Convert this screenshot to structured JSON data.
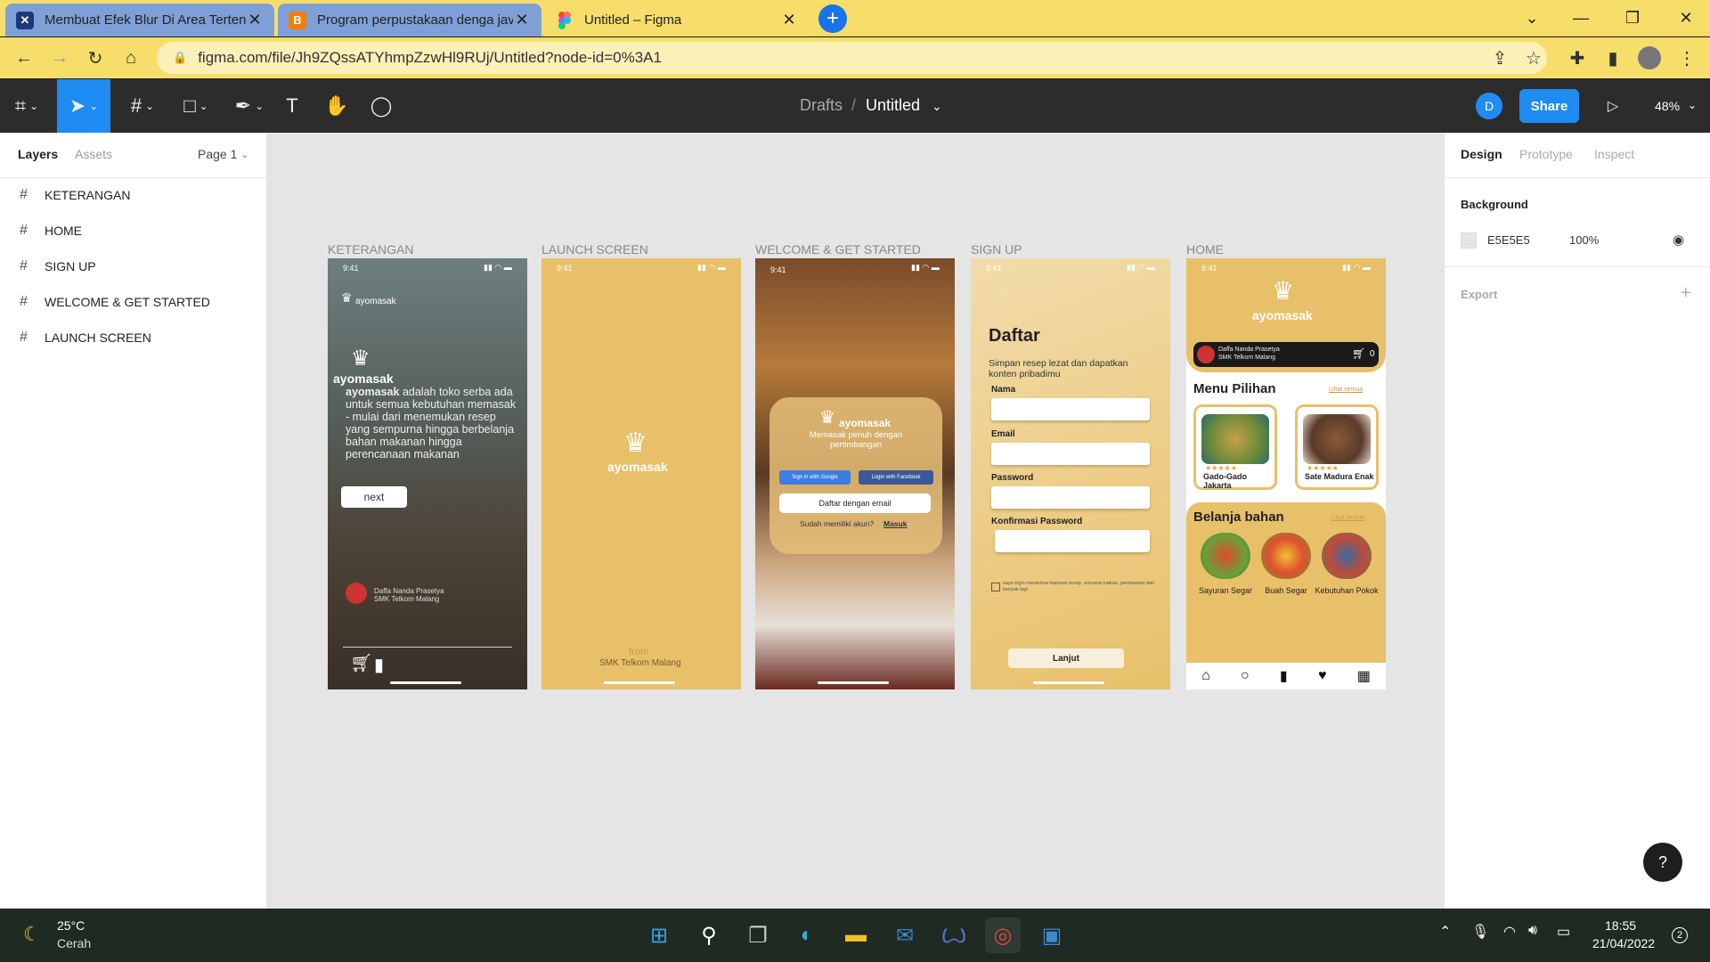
{
  "browser": {
    "tabs": [
      {
        "title": "Membuat Efek Blur Di Area Tertentu",
        "favicon": "joomla-icon"
      },
      {
        "title": "Program perpustakaan denga java",
        "favicon": "blogger-icon"
      },
      {
        "title": "Untitled – Figma",
        "favicon": "figma-icon"
      }
    ],
    "url": "figma.com/file/Jh9ZQssATYhmpZzwHl9RUj/Untitled?node-id=0%3A1"
  },
  "figma": {
    "breadcrumb_parent": "Drafts",
    "separator": "/",
    "file_name": "Untitled",
    "avatar_initial": "D",
    "share_label": "Share",
    "zoom": "48%",
    "left_tabs": {
      "layers": "Layers",
      "assets": "Assets",
      "page": "Page 1"
    },
    "layers": [
      "KETERANGAN",
      "HOME",
      "SIGN UP",
      "WELCOME & GET STARTED",
      "LAUNCH SCREEN"
    ],
    "right_tabs": {
      "design": "Design",
      "prototype": "Prototype",
      "inspect": "Inspect"
    },
    "background_label": "Background",
    "background_hex": "E5E5E5",
    "background_opacity": "100%",
    "export_label": "Export",
    "help": "?"
  },
  "frames": {
    "labels": [
      "KETERANGAN",
      "LAUNCH SCREEN",
      "WELCOME & GET STARTED",
      "SIGN UP",
      "HOME"
    ],
    "time": "9:41",
    "brand": "ayomasak",
    "keterangan": {
      "desc_bold": "ayomasak",
      "desc": "adalah toko serba ada untuk semua kebutuhan memasak - mulai dari menemukan resep yang sempurna hingga berbelanja bahan makanan hingga perencanaan makanan",
      "next": "next",
      "author": "Daffa Nanda Prasetya",
      "school": "SMK Telkom Malang"
    },
    "launch": {
      "from": "from",
      "school": "SMK Telkom Malang"
    },
    "welcome": {
      "tagline": "Memasak penuh dengan pertimbangan",
      "google": "Sign in with Google",
      "facebook": "Login with Facebook",
      "email": "Daftar dengan email",
      "have_account": "Sudah memiliki akun?",
      "login": "Masuk"
    },
    "signup": {
      "title": "Daftar",
      "subtitle": "Simpan resep lezat dan dapatkan konten pribadimu",
      "fields": [
        "Nama",
        "Email",
        "Password",
        "Konfirmasi Password"
      ],
      "checkbox": "saya ingin menerima inspirasi resep, rencana makan, pembaruan dan banyak lagi",
      "button": "Lanjut"
    },
    "home": {
      "user": "Daffa Nanda Prasetya",
      "school": "SMK Telkom Malang",
      "cart_count": "0",
      "menu_title": "Menu Pilihan",
      "see_all": "Lihat semua",
      "menu": [
        "Gado-Gado Jakarta",
        "Sate Madura Enak"
      ],
      "shop_title": "Belanja bahan",
      "shop": [
        "Sayuran Segar",
        "Buah Segar",
        "Kebutuhan Pokok"
      ]
    }
  },
  "taskbar": {
    "temp": "25°C",
    "weather": "Cerah",
    "time": "18:55",
    "date": "21/04/2022",
    "notif": "2"
  },
  "colors": {
    "tab_bar": "#f7de6a",
    "figma_blue": "#1e8cf2",
    "frame_gold": "#e8c06a"
  }
}
